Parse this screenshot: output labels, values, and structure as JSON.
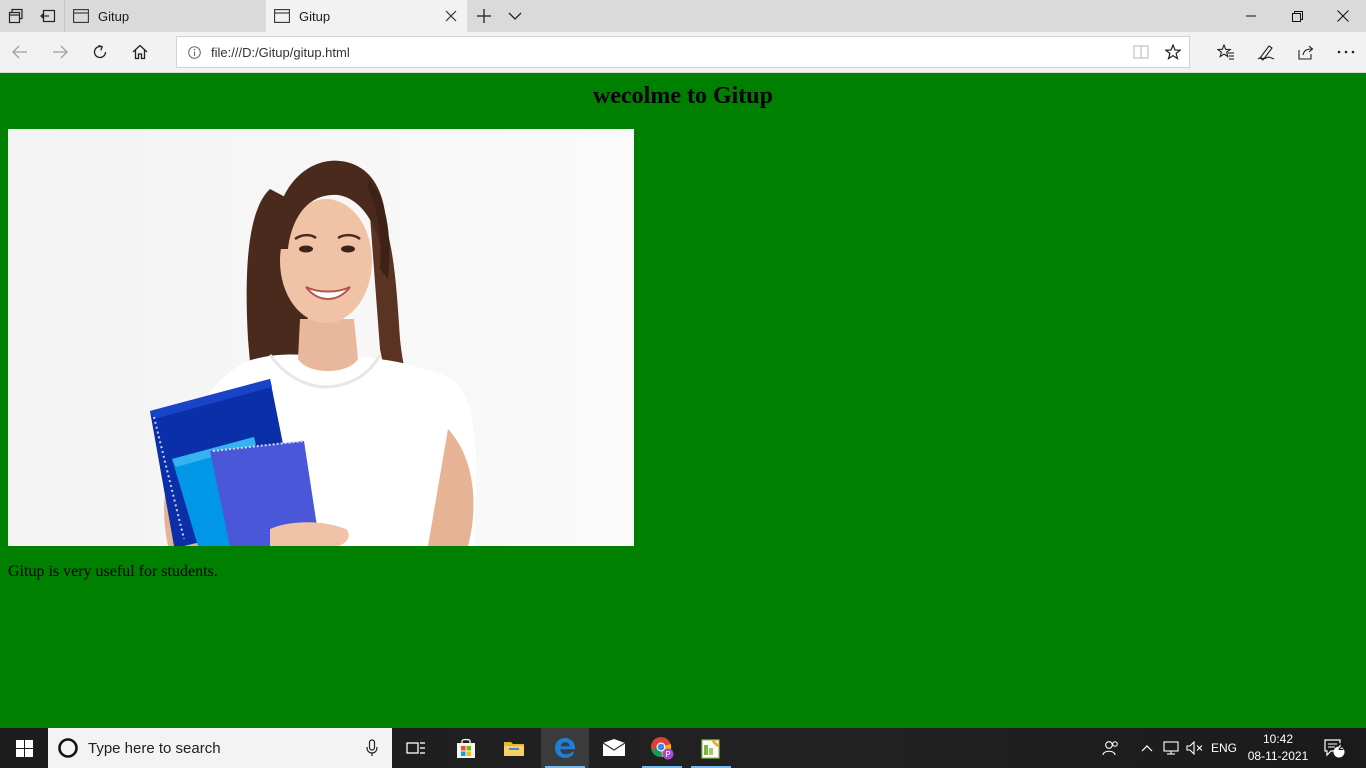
{
  "tabs": [
    {
      "title": "Gitup",
      "active": false
    },
    {
      "title": "Gitup",
      "active": true
    }
  ],
  "address": {
    "url": "file:///D:/Gitup/gitup.html"
  },
  "page": {
    "heading": "wecolme to Gitup",
    "paragraph": "Gitup is very useful for students.",
    "background_color": "#008000",
    "image_description": "student-photo"
  },
  "taskbar": {
    "search_placeholder": "Type here to search",
    "language": "ENG",
    "time": "10:42",
    "date": "08-11-2021",
    "notification_count": "2"
  },
  "colors": {
    "tab_bar": "#dadada",
    "toolbar": "#f2f2f2",
    "taskbar": "#1c1c1c",
    "edge_blue": "#1e7fd6"
  }
}
